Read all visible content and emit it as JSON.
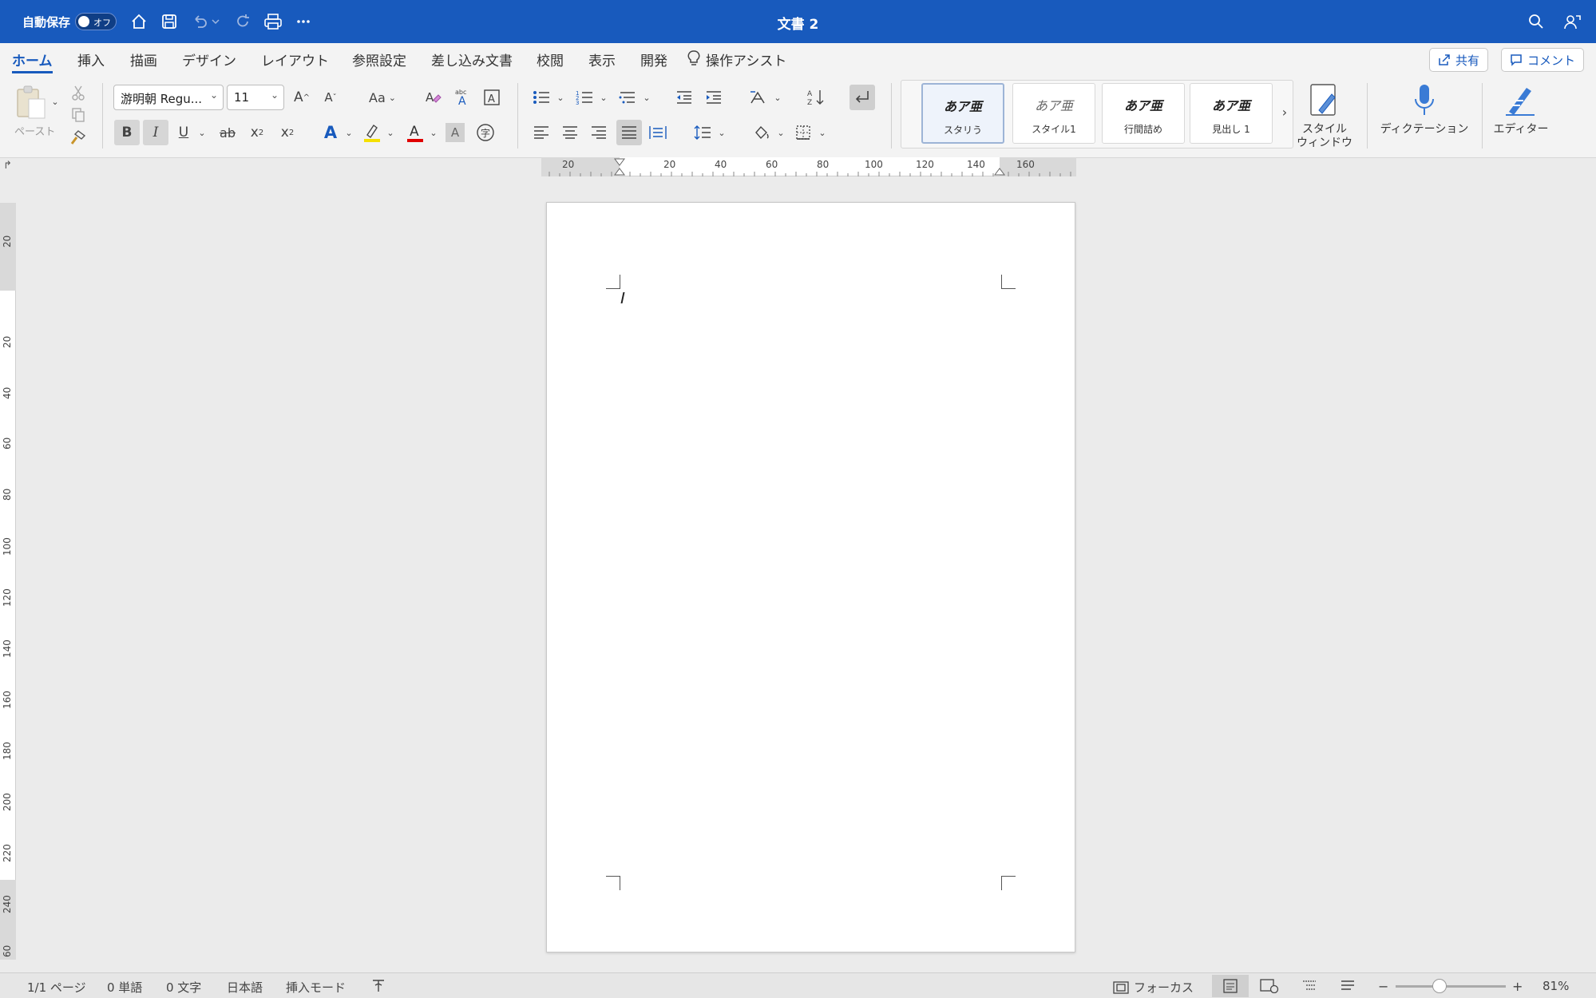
{
  "titlebar": {
    "autosave_label": "自動保存",
    "autosave_state": "オフ",
    "document_title": "文書 2"
  },
  "tabs": [
    {
      "label": "ホーム",
      "active": true
    },
    {
      "label": "挿入"
    },
    {
      "label": "描画"
    },
    {
      "label": "デザイン"
    },
    {
      "label": "レイアウト"
    },
    {
      "label": "参照設定"
    },
    {
      "label": "差し込み文書"
    },
    {
      "label": "校閲"
    },
    {
      "label": "表示"
    },
    {
      "label": "開発"
    },
    {
      "label": "操作アシスト"
    }
  ],
  "actions": {
    "share_label": "共有",
    "comment_label": "コメント"
  },
  "ribbon": {
    "paste_label": "ペースト",
    "font_name": "游明朝 Regu...",
    "font_size": "11",
    "case_label": "Aa",
    "bold": "B",
    "italic": "I",
    "underline": "U",
    "strike": "ab",
    "styles": [
      {
        "sample": "あア亜",
        "label": "スタリう"
      },
      {
        "sample": "あア亜",
        "label": "スタイル1"
      },
      {
        "sample": "あア亜",
        "label": "行間詰め"
      },
      {
        "sample": "あア亜",
        "label": "見出し 1"
      }
    ],
    "style_window_label_1": "スタイル",
    "style_window_label_2": "ウィンドウ",
    "dictation_label": "ディクテーション",
    "editor_label": "エディター"
  },
  "ruler": {
    "horizontal_ticks": [
      "20",
      "20",
      "40",
      "60",
      "80",
      "100",
      "120",
      "140",
      "160"
    ],
    "vertical_ticks": [
      "20",
      "20",
      "40",
      "60",
      "80",
      "100",
      "120",
      "140",
      "160",
      "180",
      "200",
      "220",
      "240",
      "60"
    ]
  },
  "status": {
    "page": "1/1 ページ",
    "words": "0 単語",
    "chars": "0 文字",
    "language": "日本語",
    "mode": "挿入モード",
    "focus_label": "フォーカス",
    "zoom": "81%",
    "zoom_fraction": 0.4
  },
  "colors": {
    "titlebar": "#185abd",
    "accent": "#185abd",
    "highlight": "#f5e000",
    "font_color": "#e00000"
  }
}
